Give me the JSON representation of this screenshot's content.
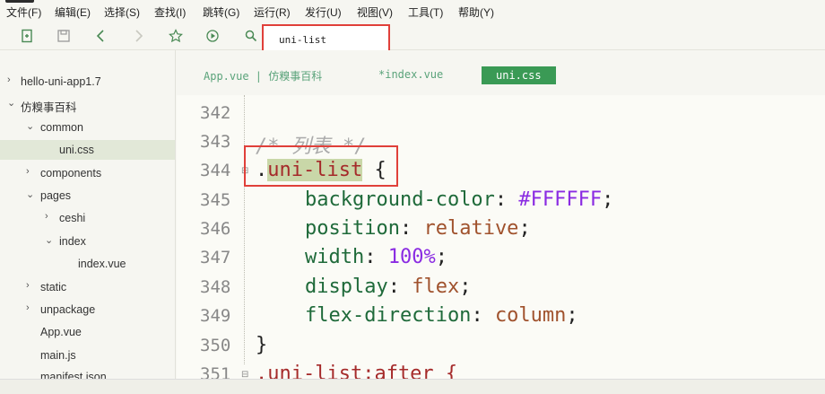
{
  "menu": [
    {
      "label": "文件(F)"
    },
    {
      "label": "编辑(E)"
    },
    {
      "label": "选择(S)"
    },
    {
      "label": "查找(I)"
    },
    {
      "label": "跳转(G)"
    },
    {
      "label": "运行(R)"
    },
    {
      "label": "发行(U)"
    },
    {
      "label": "视图(V)"
    },
    {
      "label": "工具(T)"
    },
    {
      "label": "帮助(Y)"
    }
  ],
  "toolbar": {
    "icons": [
      "new-file-icon",
      "save-icon",
      "back-icon",
      "forward-icon",
      "star-icon",
      "run-icon",
      "search-icon"
    ],
    "search_value": "uni-list"
  },
  "sidebar": {
    "items": [
      {
        "label": "hello-uni-app1.7",
        "arrow": "›"
      },
      {
        "label": "仿糗事百科",
        "arrow": "⌄"
      },
      {
        "label": "common",
        "arrow": "⌄"
      },
      {
        "label": "uni.css",
        "arrow": ""
      },
      {
        "label": "components",
        "arrow": "›"
      },
      {
        "label": "pages",
        "arrow": "⌄"
      },
      {
        "label": "ceshi",
        "arrow": "›"
      },
      {
        "label": "index",
        "arrow": "⌄"
      },
      {
        "label": "index.vue",
        "arrow": ""
      },
      {
        "label": "static",
        "arrow": "›"
      },
      {
        "label": "unpackage",
        "arrow": "›"
      },
      {
        "label": "App.vue",
        "arrow": ""
      },
      {
        "label": "main.js",
        "arrow": ""
      },
      {
        "label": "manifest.json",
        "arrow": ""
      }
    ]
  },
  "tabs": [
    {
      "label": "App.vue | 仿糗事百科"
    },
    {
      "label": "*index.vue"
    },
    {
      "label": "uni.css"
    }
  ],
  "editor": {
    "lines": [
      {
        "num": "342"
      },
      {
        "num": "343",
        "comment": "/* 列表 */"
      },
      {
        "num": "344",
        "dot": ".",
        "selector": "uni-list",
        "brace": " {"
      },
      {
        "num": "345",
        "prop": "background-color",
        "val": "#FFFFFF"
      },
      {
        "num": "346",
        "prop": "position",
        "val": "relative"
      },
      {
        "num": "347",
        "prop": "width",
        "val": "100%"
      },
      {
        "num": "348",
        "prop": "display",
        "val": "flex"
      },
      {
        "num": "349",
        "prop": "flex-direction",
        "val": "column"
      },
      {
        "num": "350",
        "close": "}"
      },
      {
        "num": "351",
        "selector2": ".uni-list:after {"
      }
    ]
  },
  "colors": {
    "accent": "#3a9a55",
    "highlight_border": "#e0403a",
    "selector": "#a52a2a",
    "property": "#1f6a3a",
    "value": "#a0522d",
    "number": "#8a2be2"
  }
}
